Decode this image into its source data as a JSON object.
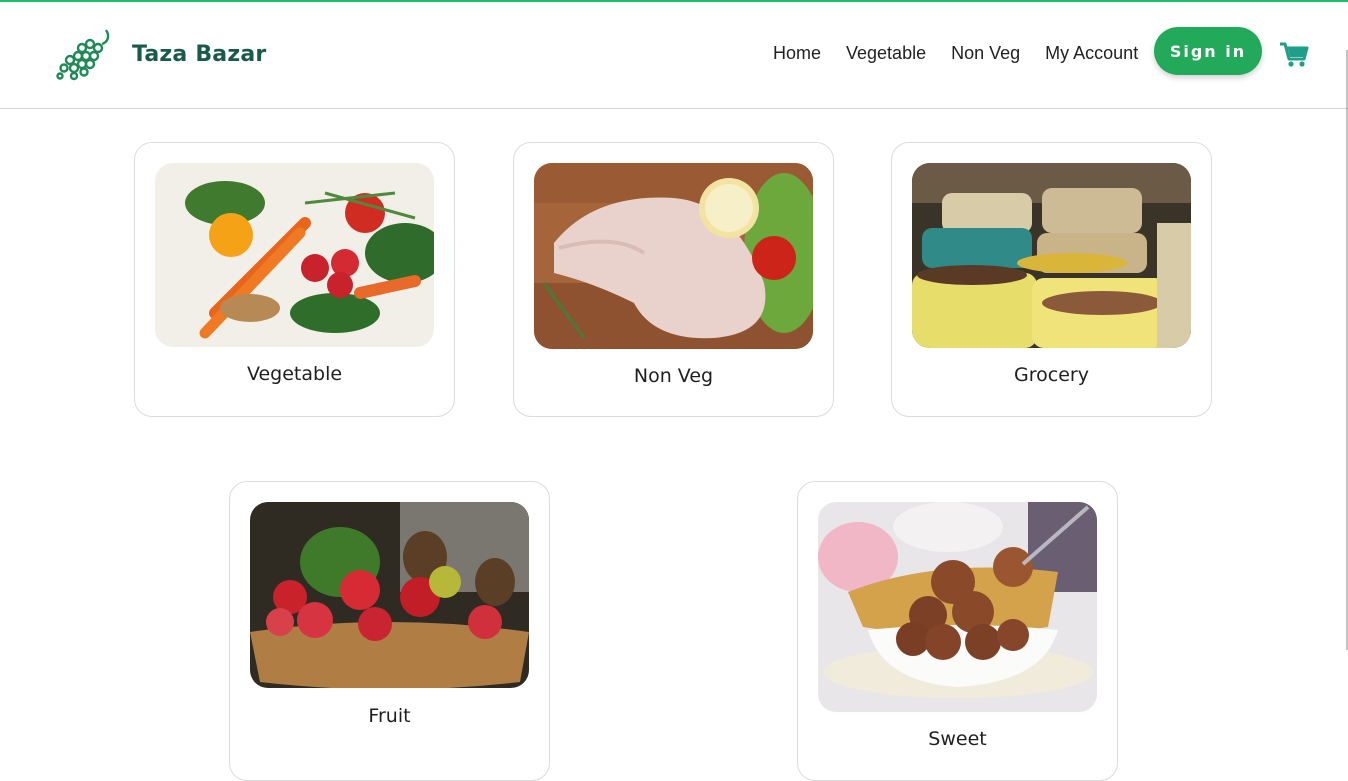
{
  "brand": {
    "name": "Taza Bazar",
    "accent": "#22a95a",
    "text_color": "#1a5a48"
  },
  "nav": {
    "items": [
      "Home",
      "Vegetable",
      "Non Veg",
      "My Account"
    ]
  },
  "header": {
    "signin_label": "Sign in",
    "cart_icon": "cart-icon"
  },
  "categories": [
    {
      "label": "Vegetable",
      "image": "vegetable-image"
    },
    {
      "label": "Non Veg",
      "image": "non-veg-image"
    },
    {
      "label": "Grocery",
      "image": "grocery-image"
    },
    {
      "label": "Fruit",
      "image": "fruit-image"
    },
    {
      "label": "Sweet",
      "image": "sweet-image"
    }
  ]
}
